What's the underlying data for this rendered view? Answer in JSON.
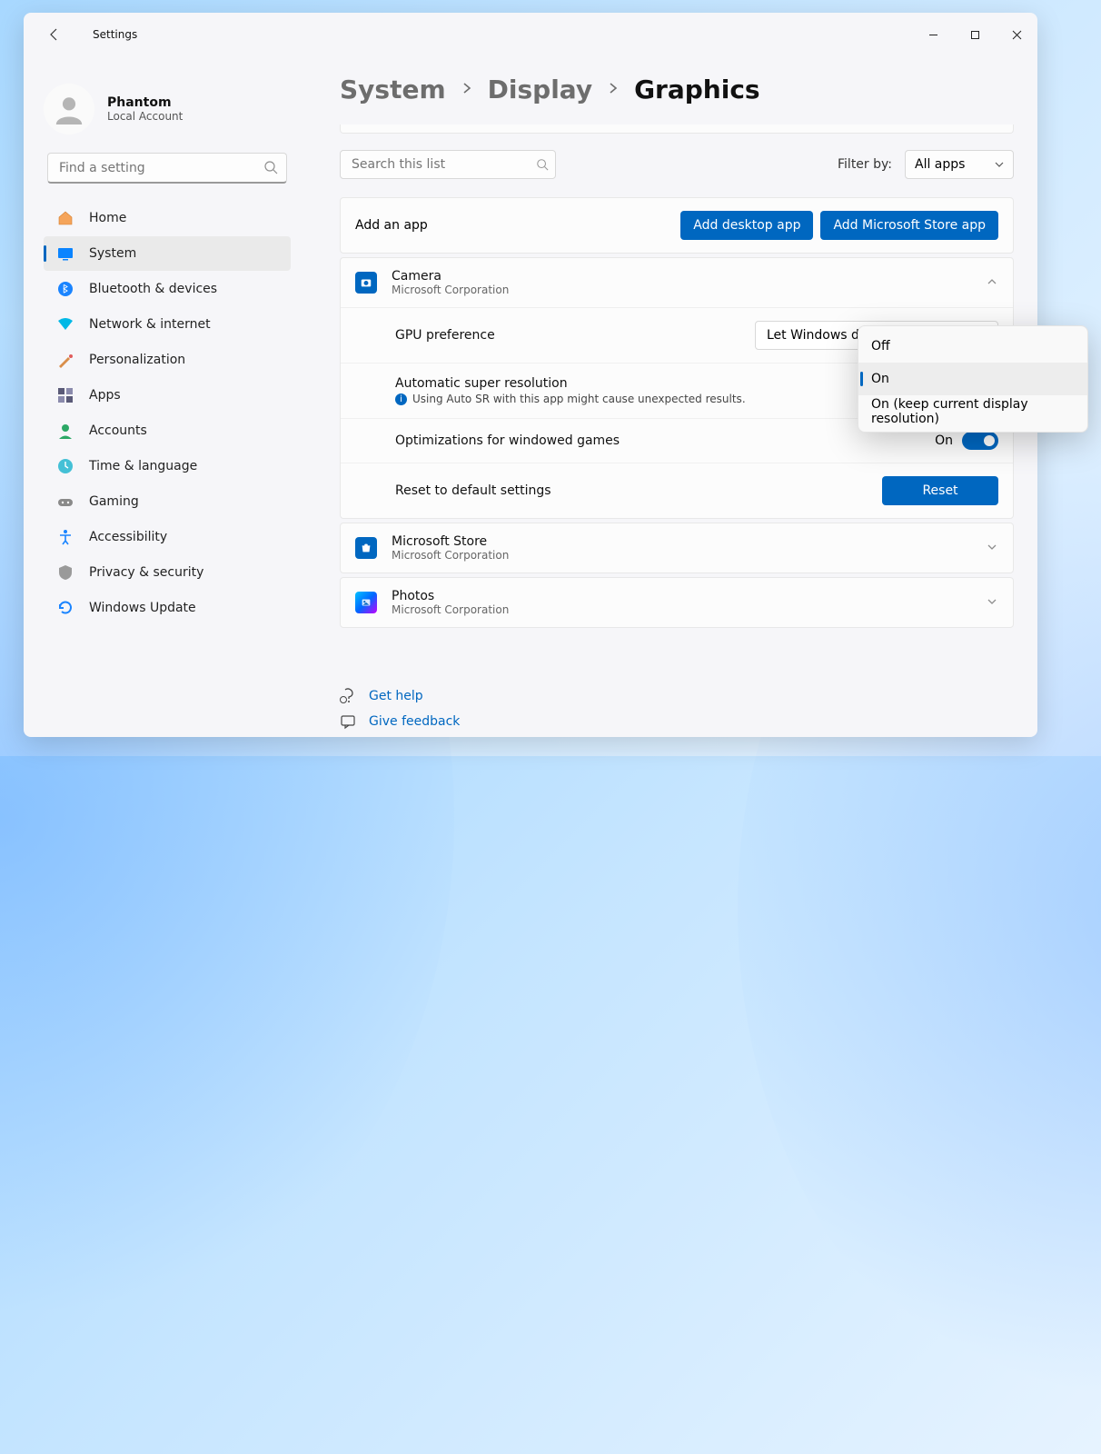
{
  "window": {
    "title": "Settings"
  },
  "user": {
    "name": "Phantom",
    "account_type": "Local Account"
  },
  "sidebar": {
    "search_placeholder": "Find a setting",
    "items": [
      {
        "label": "Home",
        "icon": "home-icon"
      },
      {
        "label": "System",
        "icon": "system-icon"
      },
      {
        "label": "Bluetooth & devices",
        "icon": "bluetooth-icon"
      },
      {
        "label": "Network & internet",
        "icon": "wifi-icon"
      },
      {
        "label": "Personalization",
        "icon": "personalization-icon"
      },
      {
        "label": "Apps",
        "icon": "apps-icon"
      },
      {
        "label": "Accounts",
        "icon": "accounts-icon"
      },
      {
        "label": "Time & language",
        "icon": "time-icon"
      },
      {
        "label": "Gaming",
        "icon": "gaming-icon"
      },
      {
        "label": "Accessibility",
        "icon": "accessibility-icon"
      },
      {
        "label": "Privacy & security",
        "icon": "privacy-icon"
      },
      {
        "label": "Windows Update",
        "icon": "update-icon"
      }
    ],
    "selected_index": 1
  },
  "breadcrumb": [
    {
      "label": "System"
    },
    {
      "label": "Display"
    },
    {
      "label": "Graphics",
      "current": true
    }
  ],
  "filter": {
    "search_placeholder": "Search this list",
    "label": "Filter by:",
    "selected": "All apps"
  },
  "add_app": {
    "label": "Add an app",
    "desktop_button": "Add desktop app",
    "store_button": "Add Microsoft Store app"
  },
  "camera_app": {
    "name": "Camera",
    "publisher": "Microsoft Corporation",
    "gpu_pref_label": "GPU preference",
    "gpu_pref_value": "Let Windows decide (Power saving)",
    "asr_label": "Automatic super resolution",
    "asr_note": "Using Auto SR with this app might cause unexpected results.",
    "opt_windowed_label": "Optimizations for windowed games",
    "opt_windowed_state": "On",
    "reset_label": "Reset to default settings",
    "reset_button": "Reset"
  },
  "store_app": {
    "name": "Microsoft Store",
    "publisher": "Microsoft Corporation"
  },
  "photos_app": {
    "name": "Photos",
    "publisher": "Microsoft Corporation"
  },
  "help": {
    "get_help": "Get help",
    "feedback": "Give feedback"
  },
  "flyout": {
    "options": [
      "Off",
      "On",
      "On (keep current display resolution)"
    ],
    "selected_index": 1
  }
}
